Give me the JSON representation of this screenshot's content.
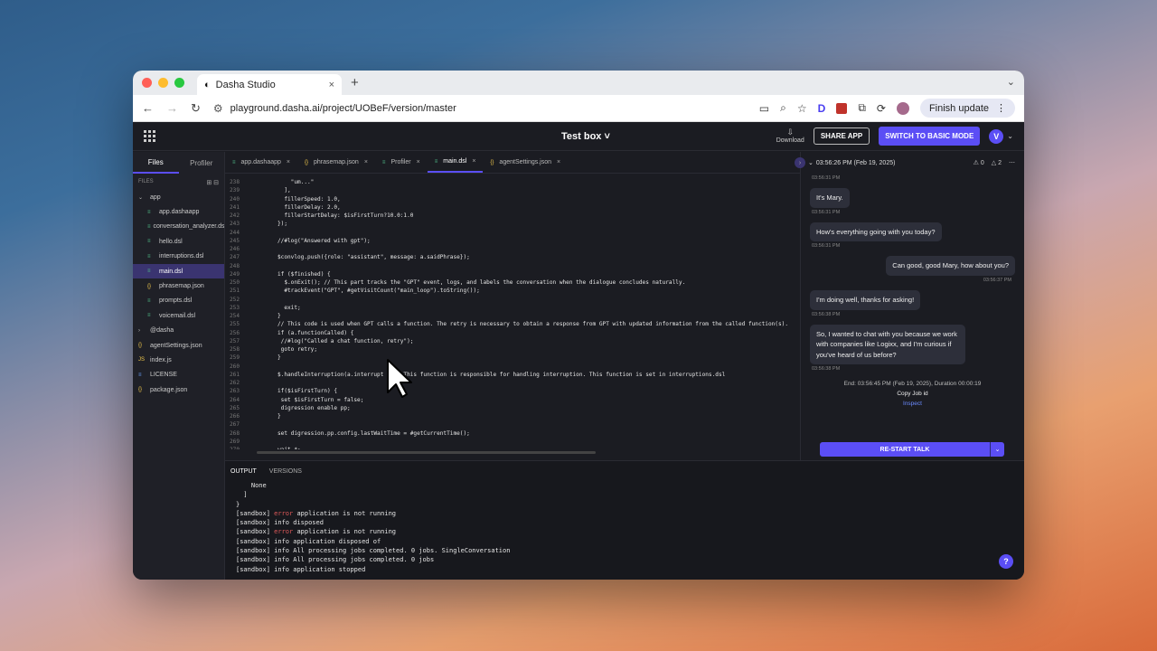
{
  "browser": {
    "tab_title": "Dasha Studio",
    "tab_close": "×",
    "new_tab": "+",
    "url": "playground.dasha.ai/project/UOBeF/version/master",
    "finish_update": "Finish update",
    "menu": "⋮"
  },
  "app": {
    "title": "Test box ˅",
    "download_label": "Download",
    "share_label": "SHARE APP",
    "switch_label": "SWITCH TO BASIC MODE",
    "user_initial": "V"
  },
  "sidebar": {
    "tabs": [
      "Files",
      "Profiler"
    ],
    "files_label": "FILES",
    "tree": [
      {
        "label": "app",
        "icon": "folder",
        "indent": 0,
        "arrow": "⌄"
      },
      {
        "label": "app.dashaapp",
        "icon": "file",
        "indent": 1
      },
      {
        "label": "conversation_analyzer.dsl",
        "icon": "file",
        "indent": 1
      },
      {
        "label": "hello.dsl",
        "icon": "file",
        "indent": 1
      },
      {
        "label": "interruptions.dsl",
        "icon": "file",
        "indent": 1
      },
      {
        "label": "main.dsl",
        "icon": "file",
        "indent": 1,
        "selected": true
      },
      {
        "label": "phrasemap.json",
        "icon": "json",
        "indent": 1
      },
      {
        "label": "prompts.dsl",
        "icon": "file",
        "indent": 1
      },
      {
        "label": "voicemail.dsl",
        "icon": "file",
        "indent": 1
      },
      {
        "label": "@dasha",
        "icon": "folder",
        "indent": 0,
        "arrow": "›"
      },
      {
        "label": "agentSettings.json",
        "icon": "json",
        "indent": 0
      },
      {
        "label": "index.js",
        "icon": "js",
        "indent": 0
      },
      {
        "label": "LICENSE",
        "icon": "lic",
        "indent": 0
      },
      {
        "label": "package.json",
        "icon": "json",
        "indent": 0
      }
    ]
  },
  "editor": {
    "tabs": [
      {
        "label": "app.dashaapp",
        "icon": "≡"
      },
      {
        "label": "phrasemap.json",
        "icon": "{}"
      },
      {
        "label": "Profiler",
        "icon": "≡"
      },
      {
        "label": "main.dsl",
        "icon": "≡",
        "active": true
      },
      {
        "label": "agentSettings.json",
        "icon": "{}"
      }
    ],
    "lines": [
      {
        "n": "238",
        "t": "    \"um...\""
      },
      {
        "n": "239",
        "t": "  ],"
      },
      {
        "n": "240",
        "t": "  fillerSpeed: 1.0,"
      },
      {
        "n": "241",
        "t": "  fillerDelay: 2.0,"
      },
      {
        "n": "242",
        "t": "  fillerStartDelay: $isFirstTurn?10.0:1.0"
      },
      {
        "n": "243",
        "t": "});"
      },
      {
        "n": "244",
        "t": ""
      },
      {
        "n": "245",
        "t": "//#log(\"Answered with gpt\");"
      },
      {
        "n": "246",
        "t": ""
      },
      {
        "n": "247",
        "t": "$convlog.push({role: \"assistant\", message: a.saidPhrase});"
      },
      {
        "n": "248",
        "t": ""
      },
      {
        "n": "249",
        "t": "if ($finished) {"
      },
      {
        "n": "250",
        "t": "  $.onExit(); // This part tracks the \"GPT\" event, logs, and labels the conversation when the dialogue concludes naturally."
      },
      {
        "n": "251",
        "t": "  #trackEvent(\"GPT\", #getVisitCount(\"main_loop\").toString());"
      },
      {
        "n": "252",
        "t": ""
      },
      {
        "n": "253",
        "t": "  exit;"
      },
      {
        "n": "254",
        "t": "}"
      },
      {
        "n": "255",
        "t": "// This code is used when GPT calls a function. The retry is necessary to obtain a response from GPT with updated information from the called function(s)."
      },
      {
        "n": "256",
        "t": "if (a.functionCalled) {"
      },
      {
        "n": "257",
        "t": " //#log(\"Called a chat function, retry\");"
      },
      {
        "n": "258",
        "t": " goto retry;"
      },
      {
        "n": "259",
        "t": "}"
      },
      {
        "n": "260",
        "t": ""
      },
      {
        "n": "261",
        "t": "$.handleInterruption(a.interrupt   // This function is responsible for handling interruption. This function is set in interruptions.dsl"
      },
      {
        "n": "262",
        "t": ""
      },
      {
        "n": "263",
        "t": "if($isFirstTurn) {"
      },
      {
        "n": "264",
        "t": " set $isFirstTurn = false;"
      },
      {
        "n": "265",
        "t": " digression enable pp;"
      },
      {
        "n": "266",
        "t": "}"
      },
      {
        "n": "267",
        "t": ""
      },
      {
        "n": "268",
        "t": "set digression.pp.config.lastWaitTime = #getCurrentTime();"
      },
      {
        "n": "269",
        "t": ""
      },
      {
        "n": "270",
        "t": "wait *;"
      },
      {
        "n": "271",
        "t": ""
      }
    ]
  },
  "chat": {
    "header_time": "03:56:26 PM (Feb 19, 2025)",
    "warnings": "0",
    "alerts": "2",
    "messages": [
      {
        "side": "left",
        "text": "",
        "time": "03:56:31 PM"
      },
      {
        "side": "left",
        "text": "It's Mary.",
        "time": "03:56:31 PM"
      },
      {
        "side": "left",
        "text": "How's everything going with you today?",
        "time": "03:56:31 PM"
      },
      {
        "side": "right",
        "text": "Can good, good Mary, how about you?",
        "time": "03:56:37 PM"
      },
      {
        "side": "left",
        "text": "I'm doing well, thanks for asking!",
        "time": "03:56:38 PM"
      },
      {
        "side": "left",
        "text": "So, I wanted to chat with you because we work with companies like Logixx, and I'm curious if you've heard of us before?",
        "time": "03:56:38 PM"
      }
    ],
    "end_text": "End: 03:56:45 PM (Feb 19, 2025), Duration 00:00:19",
    "copy_job": "Copy Job id",
    "inspect": "Inspect",
    "restart": "RE-START TALK"
  },
  "output": {
    "tabs": [
      "OUTPUT",
      "VERSIONS"
    ],
    "partial": "    None",
    "bracket1": "  ]",
    "bracket2": "}",
    "logs": [
      {
        "prefix": "[sandbox] ",
        "level": "error",
        "msg": " application is not running",
        "err": true
      },
      {
        "prefix": "[sandbox] ",
        "level": "info",
        "msg": " disposed"
      },
      {
        "prefix": "[sandbox] ",
        "level": "error",
        "msg": " application is not running",
        "err": true
      },
      {
        "prefix": "[sandbox] ",
        "level": "info",
        "msg": " application disposed of"
      },
      {
        "prefix": "[sandbox] ",
        "level": "info",
        "msg": " All processing jobs completed. 0 jobs. SingleConversation"
      },
      {
        "prefix": "[sandbox] ",
        "level": "info",
        "msg": " All processing jobs completed. 0 jobs"
      },
      {
        "prefix": "[sandbox] ",
        "level": "info",
        "msg": " application stopped"
      }
    ]
  },
  "colors": {
    "accent": "#5b4ef5",
    "error": "#e05a5a",
    "bg": "#1b1c22"
  }
}
